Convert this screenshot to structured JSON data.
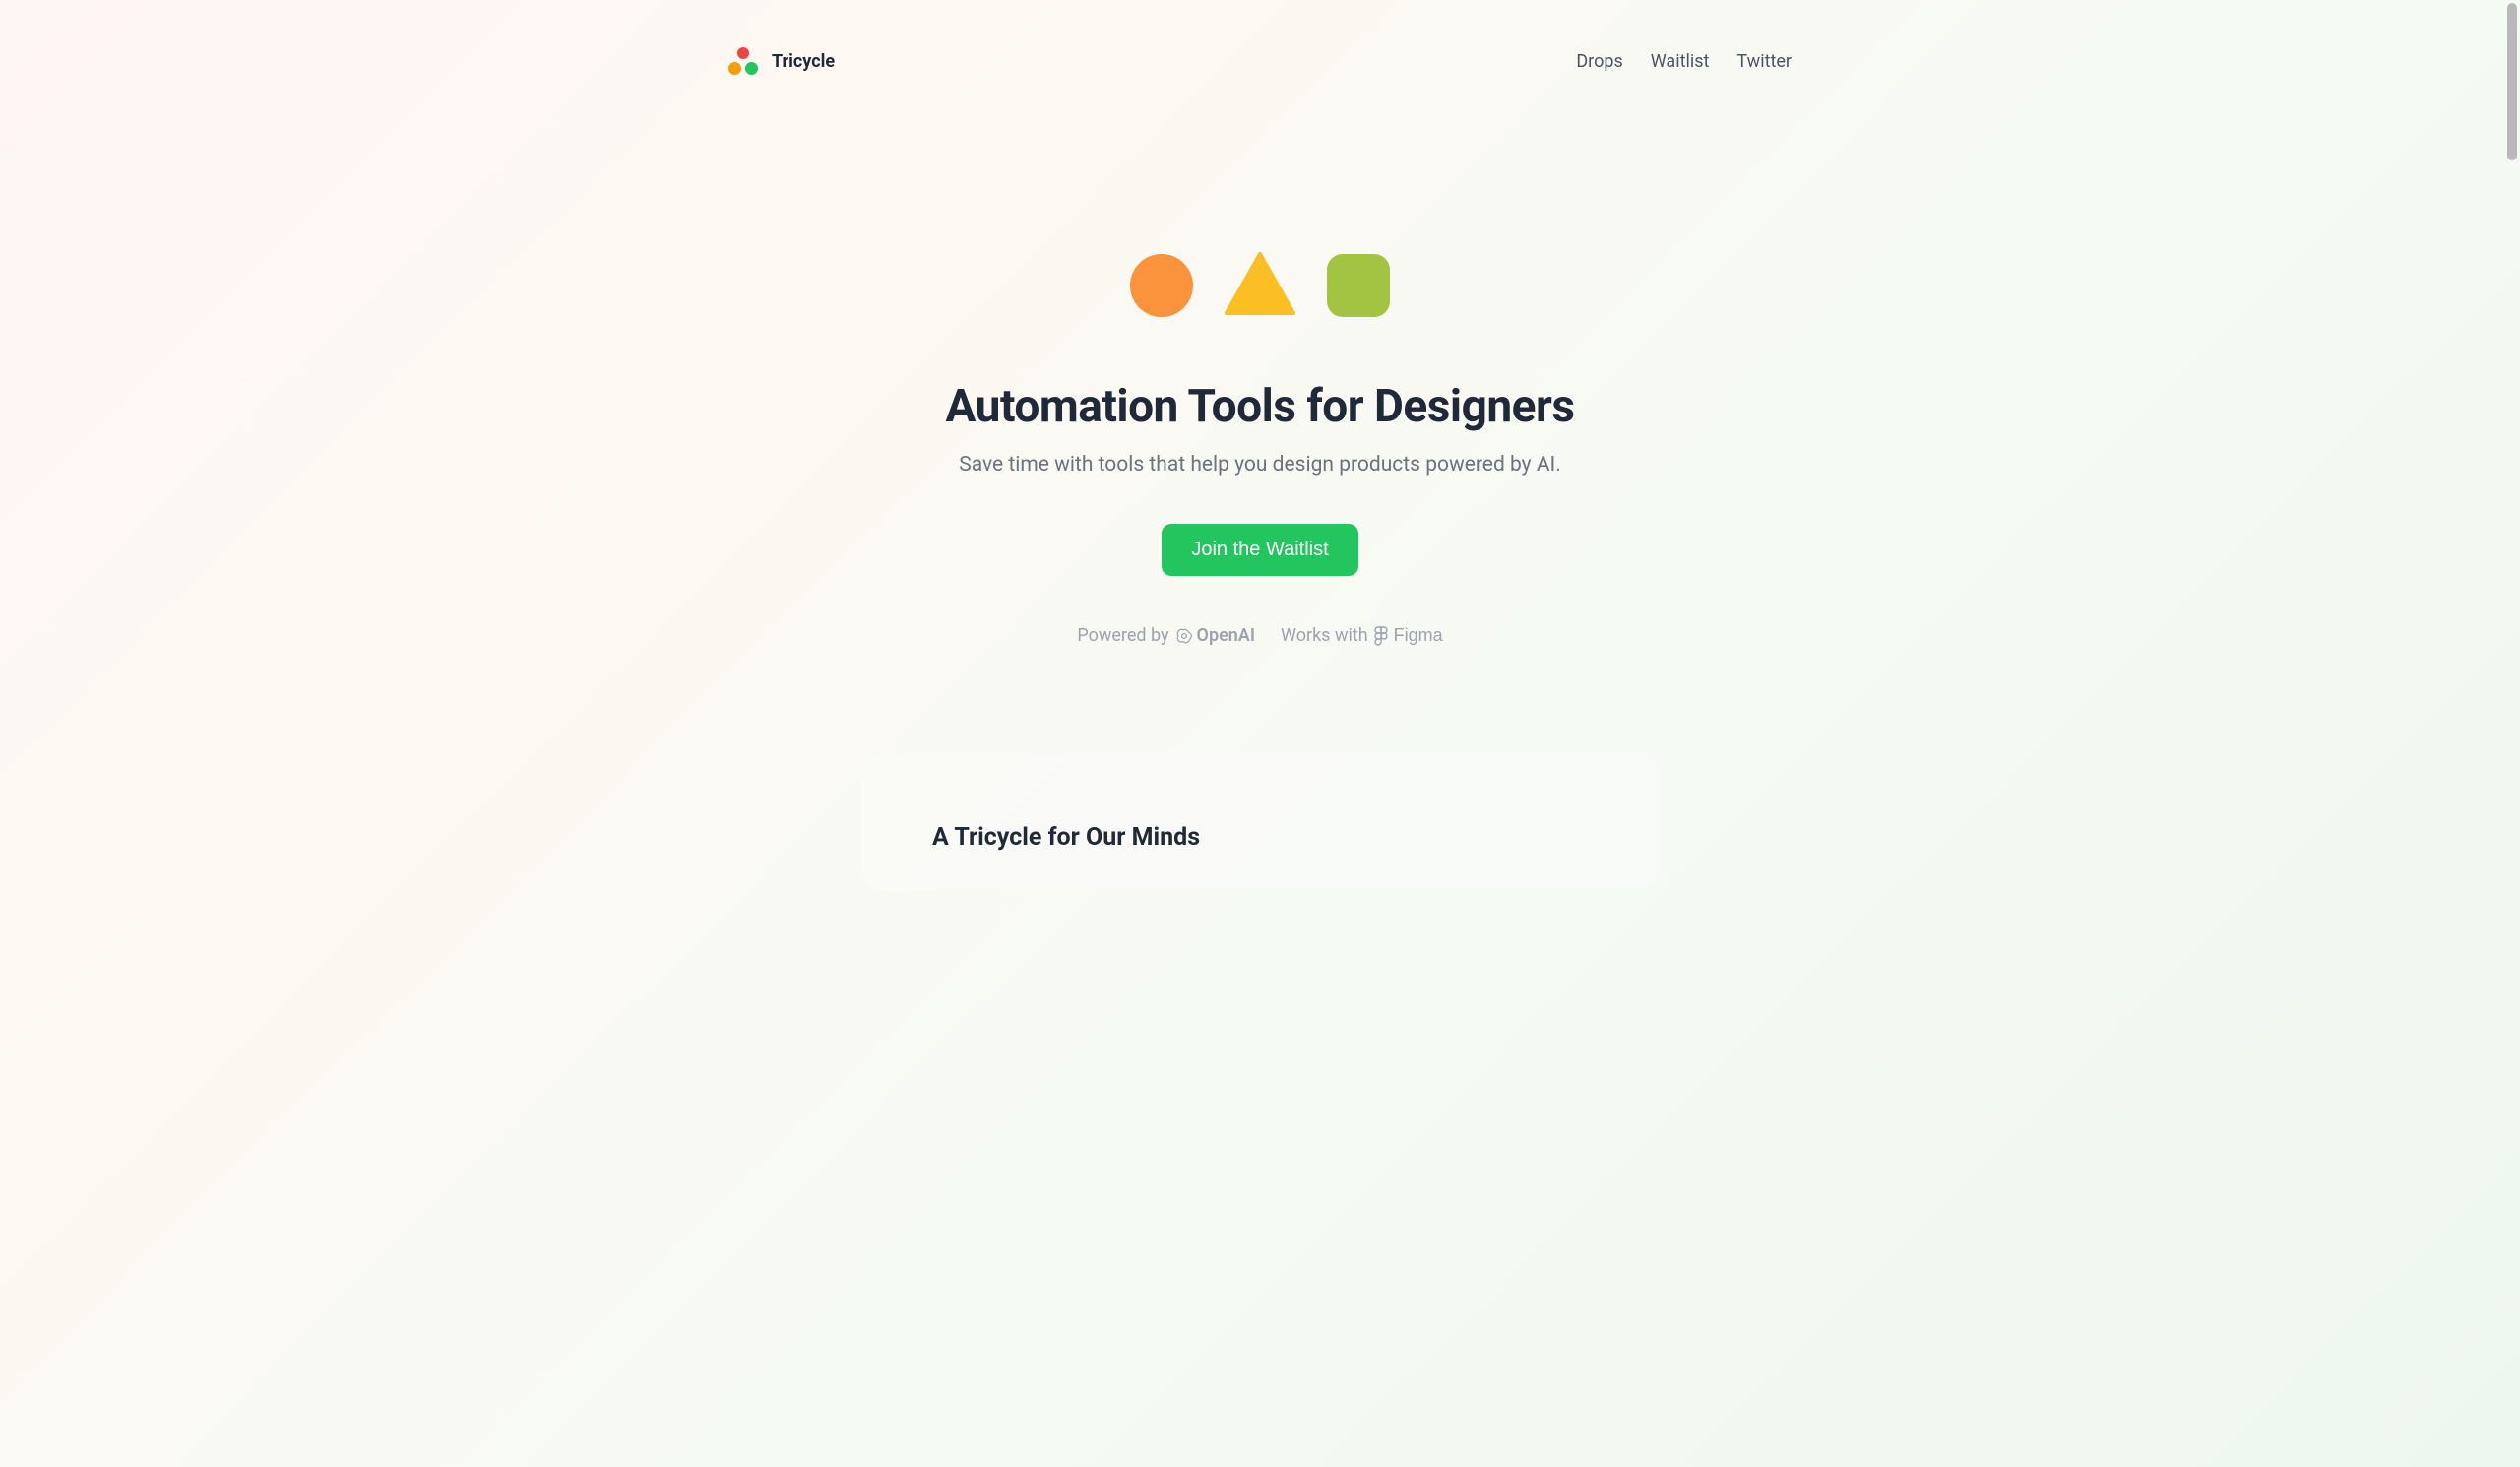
{
  "header": {
    "brand": "Tricycle",
    "nav": {
      "drops": "Drops",
      "waitlist": "Waitlist",
      "twitter": "Twitter"
    }
  },
  "hero": {
    "title": "Automation Tools for Designers",
    "subtitle": "Save time with tools that help you design products powered by AI.",
    "cta": "Join the Waitlist"
  },
  "partners": {
    "powered_label": "Powered by",
    "powered_name": "OpenAI",
    "works_label": "Works with",
    "works_name": "Figma"
  },
  "section": {
    "title": "A Tricycle for Our Minds"
  }
}
